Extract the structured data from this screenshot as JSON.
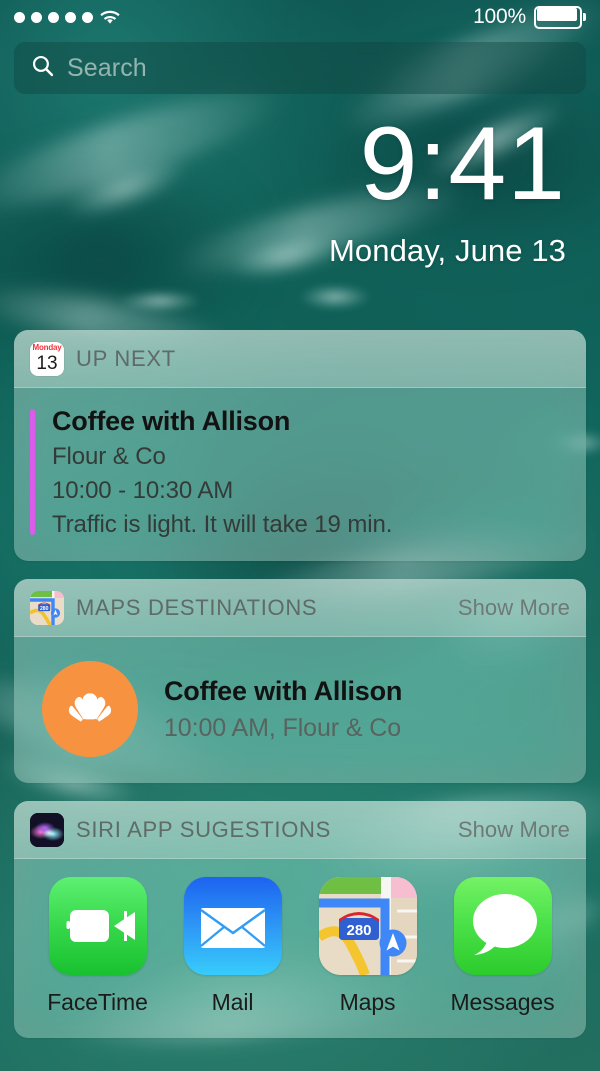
{
  "status_bar": {
    "signal_dots": 5,
    "wifi_icon": "wifi-icon",
    "battery_percent": "100%",
    "battery_icon": "battery-full-icon"
  },
  "search": {
    "icon": "search-icon",
    "placeholder": "Search",
    "value": ""
  },
  "lock_screen": {
    "time": "9:41",
    "date": "Monday, June 13"
  },
  "widgets": [
    {
      "id": "up-next",
      "title": "UP NEXT",
      "icon": "calendar-icon",
      "calendar_icon": {
        "weekday": "Monday",
        "day": "13"
      },
      "show_more": "",
      "event": {
        "accent_color": "#da5ceb",
        "title": "Coffee with Allison",
        "location": "Flour & Co",
        "time": "10:00 -  10:30 AM",
        "traffic": "Traffic is light. It will take 19 min."
      }
    },
    {
      "id": "maps-destinations",
      "title": "MAPS DESTINATIONS",
      "icon": "maps-icon",
      "show_more": "Show More",
      "destination": {
        "icon": "croissant-icon",
        "icon_color": "#f79340",
        "title": "Coffee with Allison",
        "subtitle": "10:00 AM, Flour & Co"
      }
    },
    {
      "id": "siri-app-suggestions",
      "title": "SIRI APP SUGESTIONS",
      "icon": "siri-icon",
      "show_more": "Show More",
      "apps": [
        {
          "label": "FaceTime",
          "icon": "facetime-icon"
        },
        {
          "label": "Mail",
          "icon": "mail-icon"
        },
        {
          "label": "Maps",
          "icon": "maps-icon"
        },
        {
          "label": "Messages",
          "icon": "messages-icon"
        }
      ]
    }
  ],
  "map_icon_detail": {
    "highway_shield": "280"
  },
  "colors": {
    "wallpaper": "#10605c",
    "event_accent": "#da5ceb",
    "destination_circle": "#f79340",
    "calendar_red": "#f0333c"
  }
}
